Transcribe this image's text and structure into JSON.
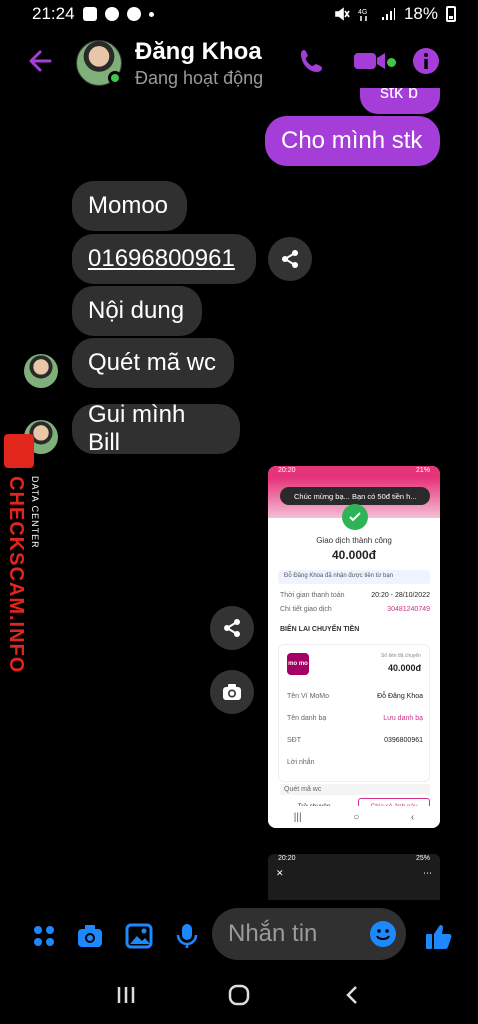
{
  "status_bar": {
    "time": "21:24",
    "battery": "18%"
  },
  "header": {
    "name": "Đăng Khoa",
    "status": "Đang hoạt động"
  },
  "messages": {
    "prev_tail": "stk b",
    "out_1": "Cho mình stk",
    "in_1": "Momoo",
    "in_2": "01696800961",
    "in_3": "Nội dung",
    "in_4": "Quét mã wc",
    "in_5": "Gui mình Bill"
  },
  "watermark": {
    "brand": "CHECKSCAM.INFO",
    "sub": "DATA CENTER"
  },
  "shared_image": {
    "status_time": "20:20",
    "status_batt": "21%",
    "notif": "Chúc mừng bạ... Bạn có 50đ tiền h...",
    "title": "Giao dịch thành công",
    "amount": "40.000đ",
    "info": "Đỗ Đăng Khoa đã nhận được tiền từ bạn",
    "time_label": "Thời gian thanh toán",
    "time_value": "20:20 - 28/10/2022",
    "code_label": "Chi tiết giao dịch",
    "code_value": "30481240749",
    "section": "BIÊN LAI CHUYỂN TIỀN",
    "momo": "mo mo",
    "card_label": "Số tiền đã chuyển",
    "card_amount": "40.000đ",
    "wallet_label": "Tên Ví MoMo",
    "wallet_value": "Đỗ Đăng Khoa",
    "contact_label": "Tên danh bạ",
    "contact_value": "Lưu danh bạ",
    "phone_label": "SĐT",
    "phone_value": "0396800961",
    "note_label": "Lời nhắn",
    "note_value": "Quét mã wc",
    "btn_back": "Trở chuyện",
    "btn_share": "Chia sẻ ảnh này"
  },
  "shared_image_2": {
    "status_time": "20:20",
    "status_batt": "25%"
  },
  "composer": {
    "placeholder": "Nhắn tin"
  },
  "colors": {
    "accent": "#a53ed9",
    "icon_blue": "#1e88ff",
    "bubble_in": "#303030"
  }
}
